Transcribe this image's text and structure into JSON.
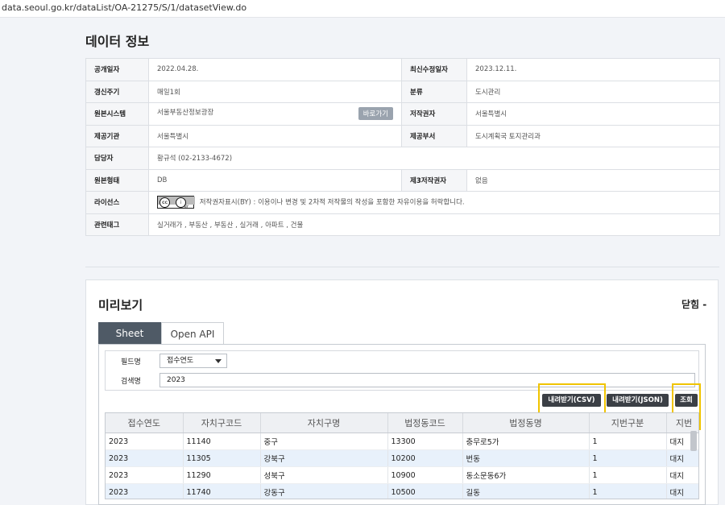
{
  "url": "data.seoul.go.kr/dataList/OA-21275/S/1/datasetView.do",
  "section_title": "데이터 정보",
  "info": {
    "publish_date_label": "공개일자",
    "publish_date": "2022.04.28.",
    "last_modified_label": "최신수정일자",
    "last_modified": "2023.12.11.",
    "update_cycle_label": "갱신주기",
    "update_cycle": "매일1회",
    "category_label": "분류",
    "category": "도시관리",
    "source_system_label": "원본시스템",
    "source_system": "서울부동산정보광장",
    "shortcut_button": "바로가기",
    "copyright_holder_label": "저작권자",
    "copyright_holder": "서울특별시",
    "provider_label": "제공기관",
    "provider": "서울특별시",
    "department_label": "제공부서",
    "department": "도시계획국 토지관리과",
    "contact_label": "담당자",
    "contact": "황규석 (02-2133-4672)",
    "source_format_label": "원본형태",
    "source_format": "DB",
    "third_party_label": "제3저작권자",
    "third_party": "없음",
    "license_label": "라이선스",
    "license_badge": "cc by",
    "license_text": "저작권자표시(BY) : 이용이나 변경 및 2차적 저작물의 작성을 포함한 자유이용을 허락합니다.",
    "tags_label": "관련태그",
    "tags": "실거래가 , 부동산 , 부동산 , 실거래 , 아파트 , 건물"
  },
  "preview": {
    "title": "미리보기",
    "close_label": "닫힘 -",
    "tab_sheet": "Sheet",
    "tab_api": "Open API",
    "field_label": "필드명",
    "field_value": "접수연도",
    "search_label": "검색명",
    "search_value": "2023",
    "btn_csv": "내려받기(CSV)",
    "btn_json": "내려받기(JSON)",
    "btn_search": "조회"
  },
  "grid": {
    "columns": [
      "접수연도",
      "자치구코드",
      "자치구명",
      "법정동코드",
      "법정동명",
      "지번구분",
      "지번"
    ],
    "rows": [
      [
        "2023",
        "11140",
        "중구",
        "13300",
        "충무로5가",
        "1",
        "대지"
      ],
      [
        "2023",
        "11305",
        "강북구",
        "10200",
        "번동",
        "1",
        "대지"
      ],
      [
        "2023",
        "11290",
        "성북구",
        "10900",
        "동소문동6가",
        "1",
        "대지"
      ],
      [
        "2023",
        "11740",
        "강동구",
        "10500",
        "길동",
        "1",
        "대지"
      ]
    ]
  },
  "colors": {
    "highlight": "#f0c400",
    "tab_active": "#4f5a66",
    "button_dark": "#3b3f45",
    "row_alt": "#e8f1fb"
  }
}
